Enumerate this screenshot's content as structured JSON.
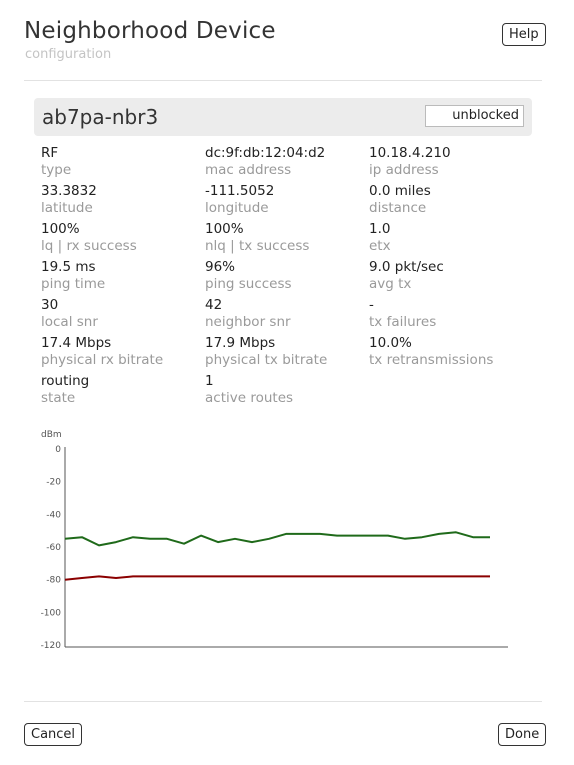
{
  "header": {
    "title": "Neighborhood Device",
    "subtitle": "configuration",
    "help_label": "Help"
  },
  "device": {
    "name": "ab7pa-nbr3",
    "block_status": "unblocked"
  },
  "stats": [
    {
      "value": "RF",
      "label": "type"
    },
    {
      "value": "dc:9f:db:12:04:d2",
      "label": "mac address"
    },
    {
      "value": "10.18.4.210",
      "label": "ip address"
    },
    {
      "value": "33.3832",
      "label": "latitude"
    },
    {
      "value": "-111.5052",
      "label": "longitude"
    },
    {
      "value": "0.0 miles",
      "label": "distance"
    },
    {
      "value": "100%",
      "label": "lq | rx success"
    },
    {
      "value": "100%",
      "label": "nlq | tx success"
    },
    {
      "value": "1.0",
      "label": "etx"
    },
    {
      "value": "19.5 ms",
      "label": "ping time"
    },
    {
      "value": "96%",
      "label": "ping success"
    },
    {
      "value": "9.0 pkt/sec",
      "label": "avg tx"
    },
    {
      "value": "30",
      "label": "local snr"
    },
    {
      "value": "42",
      "label": "neighbor snr"
    },
    {
      "value": "-",
      "label": "tx failures"
    },
    {
      "value": "17.4 Mbps",
      "label": "physical rx bitrate"
    },
    {
      "value": "17.9 Mbps",
      "label": "physical tx bitrate"
    },
    {
      "value": "10.0%",
      "label": "tx retransmissions"
    },
    {
      "value": "routing",
      "label": "state"
    },
    {
      "value": "1",
      "label": "active routes"
    }
  ],
  "footer": {
    "cancel_label": "Cancel",
    "done_label": "Done"
  },
  "colors": {
    "signal_line": "#1f6a1a",
    "noise_line": "#8b0000",
    "axis": "#555555"
  },
  "chart_data": {
    "type": "line",
    "title": "",
    "ylabel": "dBm",
    "xlabel": "",
    "ylim": [
      -120,
      0
    ],
    "yticks": [
      "0",
      "-20",
      "-40",
      "-60",
      "-80",
      "-100",
      "-120"
    ],
    "ytick_values": [
      0,
      -20,
      -40,
      -60,
      -80,
      -100,
      -120
    ],
    "grid": false,
    "x": [
      0,
      1,
      2,
      3,
      4,
      5,
      6,
      7,
      8,
      9,
      10,
      11,
      12,
      13,
      14,
      15,
      16,
      17,
      18,
      19,
      20,
      21,
      22,
      23,
      24,
      25
    ],
    "series": [
      {
        "values": [
          -55,
          -54,
          -59,
          -57,
          -54,
          -55,
          -55,
          -58,
          -53,
          -57,
          -55,
          -57,
          -55,
          -52,
          -52,
          -52,
          -53,
          -53,
          -53,
          -53,
          -55,
          -54,
          -52,
          -51,
          -54,
          -54
        ]
      },
      {
        "values": [
          -80,
          -79,
          -78,
          -79,
          -78,
          -78,
          -78,
          -78,
          -78,
          -78,
          -78,
          -78,
          -78,
          -78,
          -78,
          -78,
          -78,
          -78,
          -78,
          -78,
          -78,
          -78,
          -78,
          -78,
          -78,
          -78
        ]
      }
    ]
  }
}
